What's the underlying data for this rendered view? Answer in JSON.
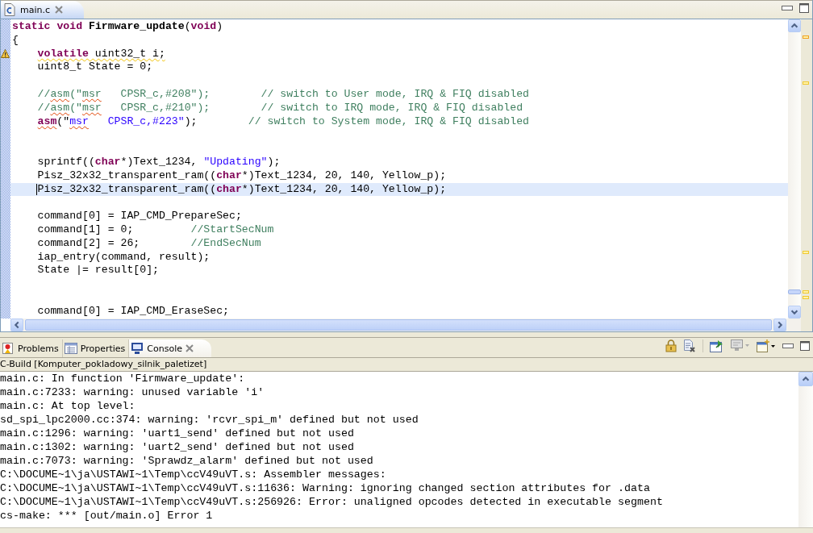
{
  "editor": {
    "tab": {
      "title": "main.c",
      "selected": true
    },
    "lines": [
      {
        "kind": "code",
        "indented": false,
        "warning": false,
        "current": false,
        "segments": [
          {
            "kind": "keyword",
            "text": "static void"
          },
          {
            "kind": "function",
            "text": " Firmware_update"
          },
          {
            "kind": "plain",
            "text": "("
          },
          {
            "kind": "keyword",
            "text": "void"
          },
          {
            "kind": "plain",
            "text": ")"
          }
        ]
      },
      {
        "kind": "code",
        "indented": false,
        "warning": false,
        "current": false,
        "segments": [
          {
            "kind": "plain",
            "text": "{"
          }
        ]
      },
      {
        "kind": "code",
        "indented": true,
        "warning": true,
        "current": false,
        "segments": [
          {
            "kind": "keyword",
            "text": "volatile",
            "warning_underline": true
          },
          {
            "kind": "plain",
            "text": " uint32_t i;",
            "warning_underline": true
          }
        ]
      },
      {
        "kind": "code",
        "indented": true,
        "warning": false,
        "current": false,
        "segments": [
          {
            "kind": "plain",
            "text": "uint8_t State = 0;"
          }
        ]
      },
      {
        "kind": "blank",
        "warning": false,
        "current": false
      },
      {
        "kind": "code",
        "indented": true,
        "warning": false,
        "current": false,
        "segments": [
          {
            "kind": "comment",
            "text": "//"
          },
          {
            "kind": "comment",
            "text": "asm",
            "spelling_underline": true
          },
          {
            "kind": "comment",
            "text": "(\""
          },
          {
            "kind": "comment",
            "text": "msr",
            "spelling_underline": true
          },
          {
            "kind": "comment",
            "text": "   CPSR_c,#208\");        // switch to User mode, IRQ & FIQ disabled"
          }
        ]
      },
      {
        "kind": "code",
        "indented": true,
        "warning": false,
        "current": false,
        "segments": [
          {
            "kind": "comment",
            "text": "//"
          },
          {
            "kind": "comment",
            "text": "asm",
            "spelling_underline": true
          },
          {
            "kind": "comment",
            "text": "(\""
          },
          {
            "kind": "comment",
            "text": "msr",
            "spelling_underline": true
          },
          {
            "kind": "comment",
            "text": "   CPSR_c,#210\");        // switch to IRQ mode, IRQ & FIQ disabled"
          }
        ]
      },
      {
        "kind": "code",
        "indented": true,
        "warning": false,
        "current": false,
        "segments": [
          {
            "kind": "keyword",
            "text": "asm",
            "spelling_underline": true
          },
          {
            "kind": "plain",
            "text": "(\""
          },
          {
            "kind": "string",
            "text": "msr",
            "spelling_underline": true
          },
          {
            "kind": "string",
            "text": "   CPSR_c,#223\""
          },
          {
            "kind": "plain",
            "text": ");        "
          },
          {
            "kind": "comment",
            "text": "// switch to System mode, IRQ & FIQ disabled"
          }
        ]
      },
      {
        "kind": "blank",
        "warning": false,
        "current": false
      },
      {
        "kind": "blank",
        "warning": false,
        "current": false
      },
      {
        "kind": "code",
        "indented": true,
        "warning": false,
        "current": false,
        "segments": [
          {
            "kind": "plain",
            "text": "sprintf(("
          },
          {
            "kind": "keyword",
            "text": "char"
          },
          {
            "kind": "plain",
            "text": "*)Text_1234, "
          },
          {
            "kind": "string",
            "text": "\"Updating\""
          },
          {
            "kind": "plain",
            "text": ");"
          }
        ]
      },
      {
        "kind": "code",
        "indented": true,
        "warning": false,
        "current": false,
        "segments": [
          {
            "kind": "plain",
            "text": "Pisz_32x32_transparent_ram(("
          },
          {
            "kind": "keyword",
            "text": "char"
          },
          {
            "kind": "plain",
            "text": "*)Text_1234, 20, 140, Yellow_p);"
          }
        ]
      },
      {
        "kind": "code",
        "indented": true,
        "warning": false,
        "current": true,
        "segments": [
          {
            "kind": "plain",
            "text": "Pisz_32x32_transparent_ram(("
          },
          {
            "kind": "keyword",
            "text": "char"
          },
          {
            "kind": "plain",
            "text": "*)Text_1234, 20, 140, Yellow_p);"
          }
        ]
      },
      {
        "kind": "blank",
        "warning": false,
        "current": false
      },
      {
        "kind": "code",
        "indented": true,
        "warning": false,
        "current": false,
        "segments": [
          {
            "kind": "plain",
            "text": "command[0] = IAP_CMD_PrepareSec;"
          }
        ]
      },
      {
        "kind": "code",
        "indented": true,
        "warning": false,
        "current": false,
        "segments": [
          {
            "kind": "plain",
            "text": "command[1] = 0;         "
          },
          {
            "kind": "comment",
            "text": "//StartSecNum"
          }
        ]
      },
      {
        "kind": "code",
        "indented": true,
        "warning": false,
        "current": false,
        "segments": [
          {
            "kind": "plain",
            "text": "command[2] = 26;        "
          },
          {
            "kind": "comment",
            "text": "//EndSecNum"
          }
        ]
      },
      {
        "kind": "code",
        "indented": true,
        "warning": false,
        "current": false,
        "segments": [
          {
            "kind": "plain",
            "text": "iap_entry(command, result);"
          }
        ]
      },
      {
        "kind": "code",
        "indented": true,
        "warning": false,
        "current": false,
        "segments": [
          {
            "kind": "plain",
            "text": "State |= result[0];"
          }
        ]
      },
      {
        "kind": "blank",
        "warning": false,
        "current": false
      },
      {
        "kind": "blank",
        "warning": false,
        "current": false
      },
      {
        "kind": "code",
        "indented": true,
        "warning": false,
        "current": false,
        "segments": [
          {
            "kind": "plain",
            "text": "command[0] = IAP_CMD_EraseSec;"
          }
        ]
      }
    ]
  },
  "panel": {
    "tabs": [
      {
        "kind": "problems",
        "label": "Problems",
        "selected": false
      },
      {
        "kind": "properties",
        "label": "Properties",
        "selected": false
      },
      {
        "kind": "console",
        "label": "Console",
        "selected": true
      }
    ],
    "console_title": "C-Build [Komputer_pokladowy_silnik_paletizet]",
    "console_lines": [
      "main.c: In function 'Firmware_update':",
      "main.c:7233: warning: unused variable 'i'",
      "main.c: At top level:",
      "sd_spi_lpc2000.cc:374: warning: 'rcvr_spi_m' defined but not used",
      "main.c:1296: warning: 'uart1_send' defined but not used",
      "main.c:1302: warning: 'uart2_send' defined but not used",
      "main.c:7073: warning: 'Sprawdz_alarm' defined but not used",
      "C:\\DOCUME~1\\ja\\USTAWI~1\\Temp\\ccV49uVT.s: Assembler messages:",
      "C:\\DOCUME~1\\ja\\USTAWI~1\\Temp\\ccV49uVT.s:11636: Warning: ignoring changed section attributes for .data",
      "C:\\DOCUME~1\\ja\\USTAWI~1\\Temp\\ccV49uVT.s:256926: Error: unaligned opcodes detected in executable segment",
      "cs-make: *** [out/main.o] Error 1"
    ]
  }
}
